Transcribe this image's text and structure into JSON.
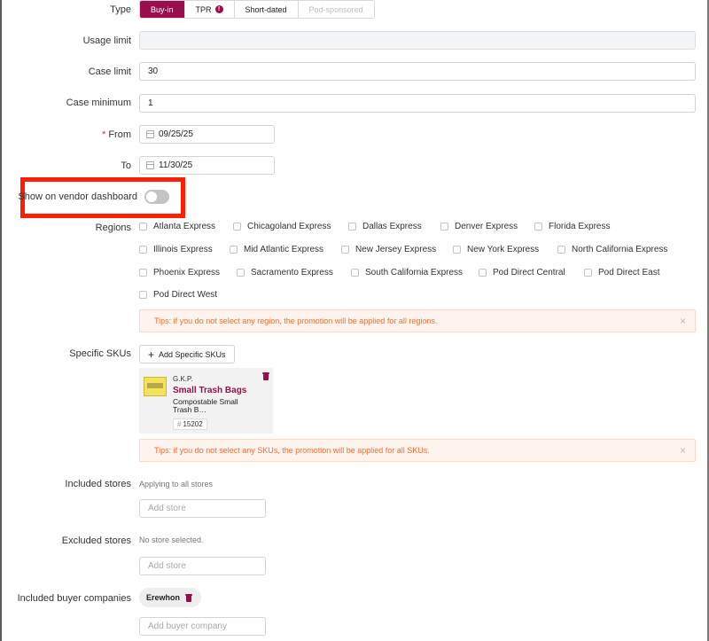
{
  "form": {
    "type": {
      "label": "Type",
      "options": [
        {
          "label": "Buy-in",
          "state": "active"
        },
        {
          "label": "TPR",
          "state": "normal"
        },
        {
          "label": "Short-dated",
          "state": "normal"
        },
        {
          "label": "Pod-sponsored",
          "state": "disabled"
        }
      ]
    },
    "usage_limit": {
      "label": "Usage limit",
      "value": ""
    },
    "case_limit": {
      "label": "Case limit",
      "value": "30"
    },
    "case_minimum": {
      "label": "Case minimum",
      "value": "1"
    },
    "from": {
      "required_mark": "*",
      "label": "From",
      "value": "09/25/25"
    },
    "to": {
      "label": "To",
      "value": "11/30/25"
    },
    "vendor_dashboard": {
      "label": "Show on vendor dashboard",
      "enabled": false
    },
    "regions": {
      "label": "Regions",
      "items": [
        "Atlanta Express",
        "Chicagoland Express",
        "Dallas Express",
        "Denver Express",
        "Florida Express",
        "Illinois Express",
        "Mid Atlantic Express",
        "New Jersey Express",
        "New York Express",
        "North California Express",
        "Phoenix Express",
        "Sacramento Express",
        "South California Express",
        "Pod Direct Central",
        "Pod Direct East",
        "Pod Direct West"
      ],
      "tip": "Tips: if you do not select any region, the promotion will be applied for all regions."
    },
    "specific_skus": {
      "label": "Specific SKUs",
      "add_label": "Add Specific SKUs",
      "items": [
        {
          "brand": "G.K.P.",
          "name": "Small Trash Bags",
          "desc_line1": "Compostable Small",
          "desc_line2": "Trash B…",
          "id": "15202"
        }
      ],
      "tip": "Tips: if you do not select any SKUs, the promotion will be applied for all SKUs."
    },
    "included_stores": {
      "label": "Included stores",
      "status": "Applying to all stores",
      "placeholder": "Add store"
    },
    "excluded_stores": {
      "label": "Excluded stores",
      "status": "No store selected.",
      "placeholder": "Add store"
    },
    "included_buyers": {
      "label": "Included buyer companies",
      "chips": [
        "Erewhon"
      ],
      "placeholder": "Add buyer company"
    }
  },
  "colors": {
    "accent": "#9a0e4d",
    "highlight": "#ff1f00",
    "tip_text": "#ff6a2a"
  }
}
